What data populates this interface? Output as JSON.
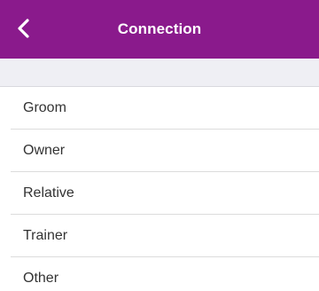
{
  "header": {
    "title": "Connection",
    "back_icon": "chevron-left-icon",
    "background_color": "#8a1a8c",
    "title_color": "#ffffff"
  },
  "list": {
    "items": [
      {
        "label": "Groom"
      },
      {
        "label": "Owner"
      },
      {
        "label": "Relative"
      },
      {
        "label": "Trainer"
      },
      {
        "label": "Other"
      }
    ]
  },
  "colors": {
    "section_background": "#efeff4",
    "divider": "#dcdcdc",
    "text": "#333333"
  }
}
